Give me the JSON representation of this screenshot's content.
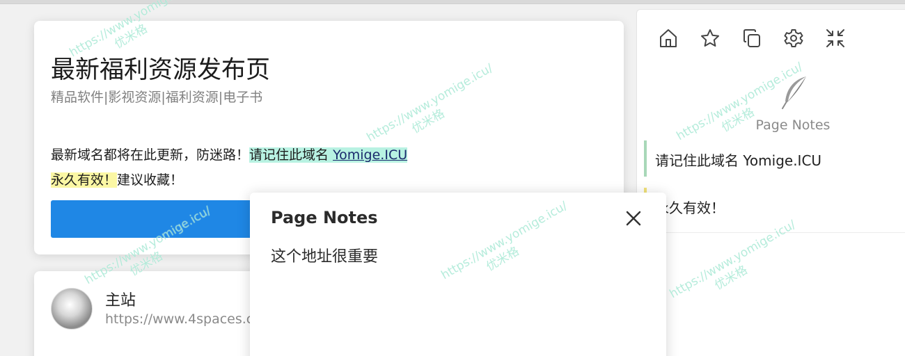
{
  "main_card": {
    "title": "最新福利资源发布页",
    "subtitle": "精品软件|影视资源|福利资源|电子书",
    "notice_prefix": "最新域名都将在此更新，防迷路！",
    "notice_highlight": "请记住此域名 ",
    "notice_link": "Yomige.ICU",
    "notice_permanent": "永久有效！",
    "notice_suffix": "建议收藏！"
  },
  "site_card": {
    "name": "主站",
    "url": "https://www.4spaces.c"
  },
  "sidebar": {
    "toolbar": [
      "home-icon",
      "star-icon",
      "copy-icon",
      "gear-icon",
      "collapse-icon"
    ],
    "app_name": "Page Notes",
    "notes": [
      {
        "text": "请记住此域名 Yomige.ICU",
        "color": "#a8d8b8"
      },
      {
        "text": "永久有效！",
        "color": "#f2e27a"
      }
    ]
  },
  "popup": {
    "title": "Page Notes",
    "body": "这个地址很重要"
  },
  "watermark": {
    "url": "https://www.yomige.icu/",
    "name": "优米格"
  },
  "colors": {
    "accent_blue": "#1f87e5",
    "highlight_green": "#b8f2e2",
    "highlight_yellow": "#fbf7a4"
  }
}
